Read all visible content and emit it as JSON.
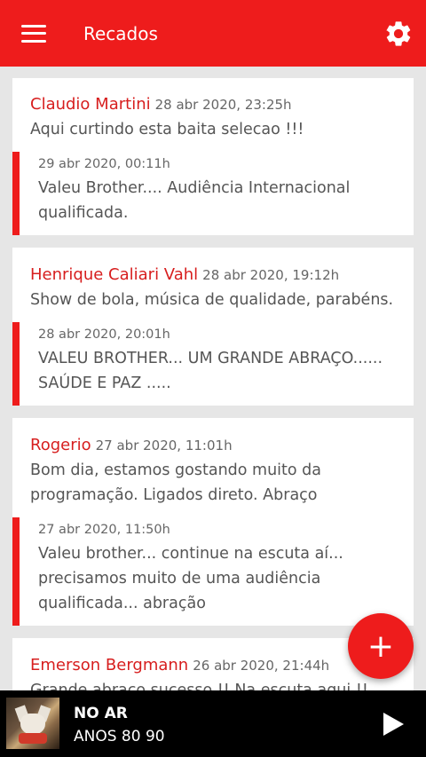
{
  "header": {
    "title": "Recados"
  },
  "messages": [
    {
      "author": "Claudio Martini",
      "date": "28 abr 2020, 23:25h",
      "text": "Aqui curtindo esta baita selecao !!!",
      "reply": {
        "date": "29 abr 2020, 00:11h",
        "text": "Valeu Brother.... Audiência Internacional qualificada."
      }
    },
    {
      "author": "Henrique Caliari Vahl",
      "date": "28 abr 2020, 19:12h",
      "text": "Show de bola, música de qualidade, parabéns.",
      "reply": {
        "date": "28 abr 2020, 20:01h",
        "text": "VALEU BROTHER...   UM GRANDE ABRAÇO...... SAÚDE E PAZ ....."
      }
    },
    {
      "author": "Rogerio",
      "date": "27 abr 2020, 11:01h",
      "text": "Bom dia, estamos gostando muito da programação.  Ligados direto. Abraço",
      "reply": {
        "date": "27 abr 2020, 11:50h",
        "text": "Valeu brother...   continue na escuta aí... precisamos muito de uma audiência qualificada...   abração"
      }
    },
    {
      "author": "Emerson Bergmann",
      "date": "26 abr 2020, 21:44h",
      "text": "Grande abraço sucesso !! Na escuta aqui !!"
    }
  ],
  "fab": {
    "icon": "plus-icon",
    "label": "+"
  },
  "player": {
    "status": "NO AR",
    "station": "ANOS 80 90"
  },
  "colors": {
    "accent": "#ee1c1c",
    "author": "#d71e1e",
    "background": "#e6e6e6",
    "player_bg": "#000000"
  }
}
